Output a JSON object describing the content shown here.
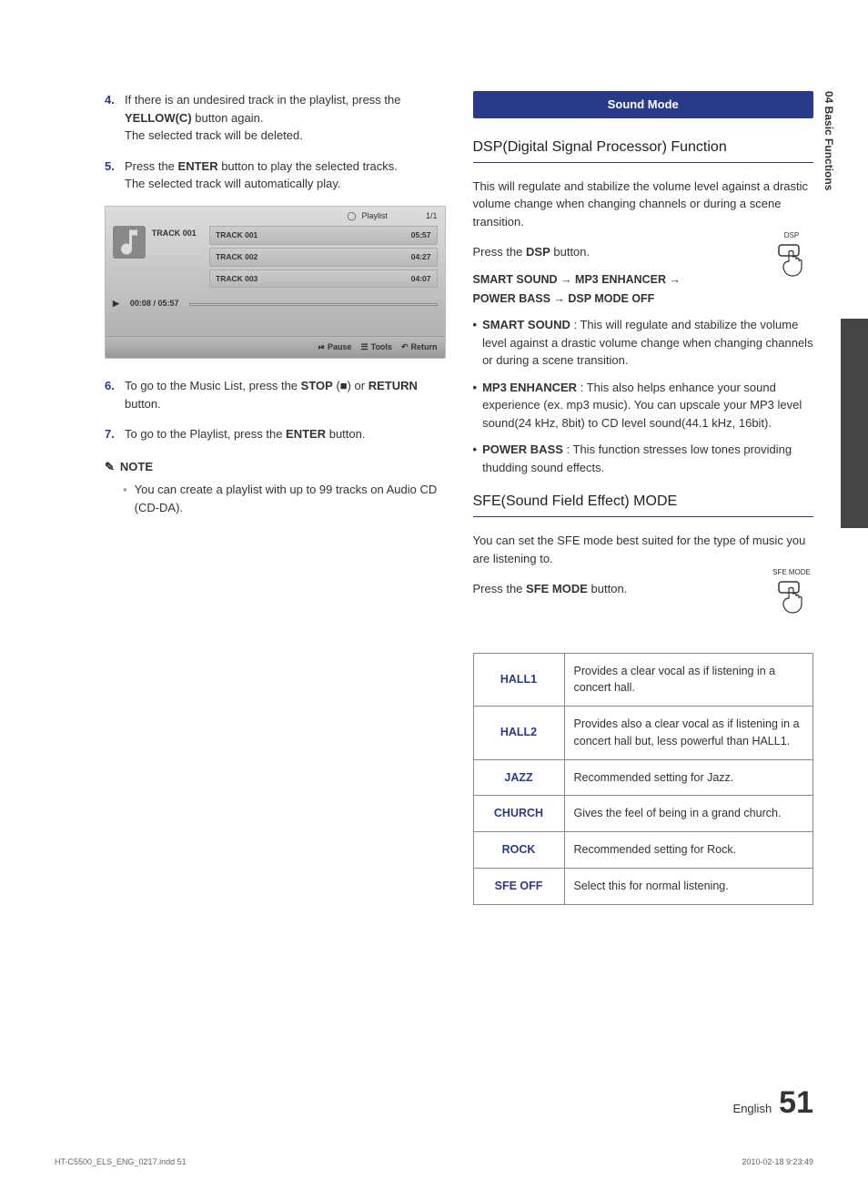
{
  "sideTab": "04  Basic Functions",
  "left": {
    "steps": [
      {
        "num": "4.",
        "body_pre": "If there is an undesired track in the playlist, press the ",
        "bold1": "YELLOW(C)",
        "body_mid": " button again.",
        "body_after": "The selected track will be deleted."
      },
      {
        "num": "5.",
        "body_pre": "Press the ",
        "bold1": "ENTER",
        "body_mid": " button to play the selected tracks.",
        "body_after": "The selected track will automatically play."
      }
    ],
    "screenshot": {
      "headerPlaylist": "Playlist",
      "headerPage": "1/1",
      "nowTitle": "TRACK 001",
      "rows": [
        {
          "t": "TRACK 001",
          "d": "05:57"
        },
        {
          "t": "TRACK 002",
          "d": "04:27"
        },
        {
          "t": "TRACK 003",
          "d": "04:07"
        }
      ],
      "playTime": "00:08 / 05:57",
      "footPause": "Pause",
      "footTools": "Tools",
      "footReturn": "Return"
    },
    "steps2": [
      {
        "num": "6.",
        "body_pre": "To go to the Music List, press the ",
        "bold1": "STOP",
        "body_mid": " (■) or ",
        "bold2": "RETURN",
        "body_after": " button."
      },
      {
        "num": "7.",
        "body_pre": "To go to the Playlist, press the ",
        "bold1": "ENTER",
        "body_mid": " button.",
        "body_after": ""
      }
    ],
    "noteLabel": "NOTE",
    "noteBody": "You can create a playlist with up to 99 tracks on Audio CD (CD-DA)."
  },
  "right": {
    "sectionTitle": "Sound Mode",
    "h1": "DSP(Digital Signal Processor) Function",
    "p1": "This will regulate and stabilize the volume level against a drastic volume change when changing channels or during a scene transition.",
    "press_dsp_pre": "Press the ",
    "press_dsp_bold": "DSP",
    "press_dsp_post": " button.",
    "dspLabel": "DSP",
    "modeLine": {
      "a": "SMART SOUND",
      "b": "MP3 ENHANCER",
      "c": "POWER BASS",
      "d": "DSP MODE OFF"
    },
    "bullets": [
      {
        "name": "SMART SOUND",
        "desc": " : This will regulate and stabilize the volume level against a drastic volume change when changing channels or during a scene transition."
      },
      {
        "name": "MP3 ENHANCER ",
        "desc": " : This also helps enhance your sound experience (ex. mp3 music). You can upscale your MP3 level sound(24 kHz, 8bit) to CD level sound(44.1 kHz, 16bit)."
      },
      {
        "name": "POWER BASS",
        "desc": " : This function stresses low tones providing thudding sound effects."
      }
    ],
    "h2": "SFE(Sound Field Effect) MODE",
    "p2": "You can set the SFE mode best suited for the type of music you are listening to.",
    "press_sfe_pre": "Press the ",
    "press_sfe_bold": "SFE MODE",
    "press_sfe_post": " button.",
    "sfeLabel": "SFE MODE",
    "table": [
      {
        "n": "HALL1",
        "d": "Provides a clear vocal as if listening in a concert hall."
      },
      {
        "n": "HALL2",
        "d": "Provides also a clear vocal as if listening in a concert hall but, less powerful than HALL1."
      },
      {
        "n": "JAZZ",
        "d": "Recommended setting for Jazz."
      },
      {
        "n": "CHURCH",
        "d": "Gives the feel of being in a grand church."
      },
      {
        "n": "ROCK",
        "d": "Recommended setting for Rock."
      },
      {
        "n": "SFE OFF",
        "d": "Select this for normal listening."
      }
    ]
  },
  "footer": {
    "lang": "English",
    "page": "51"
  },
  "print": {
    "file": "HT-C5500_ELS_ENG_0217.indd   51",
    "time": "2010-02-18   9:23:49"
  }
}
